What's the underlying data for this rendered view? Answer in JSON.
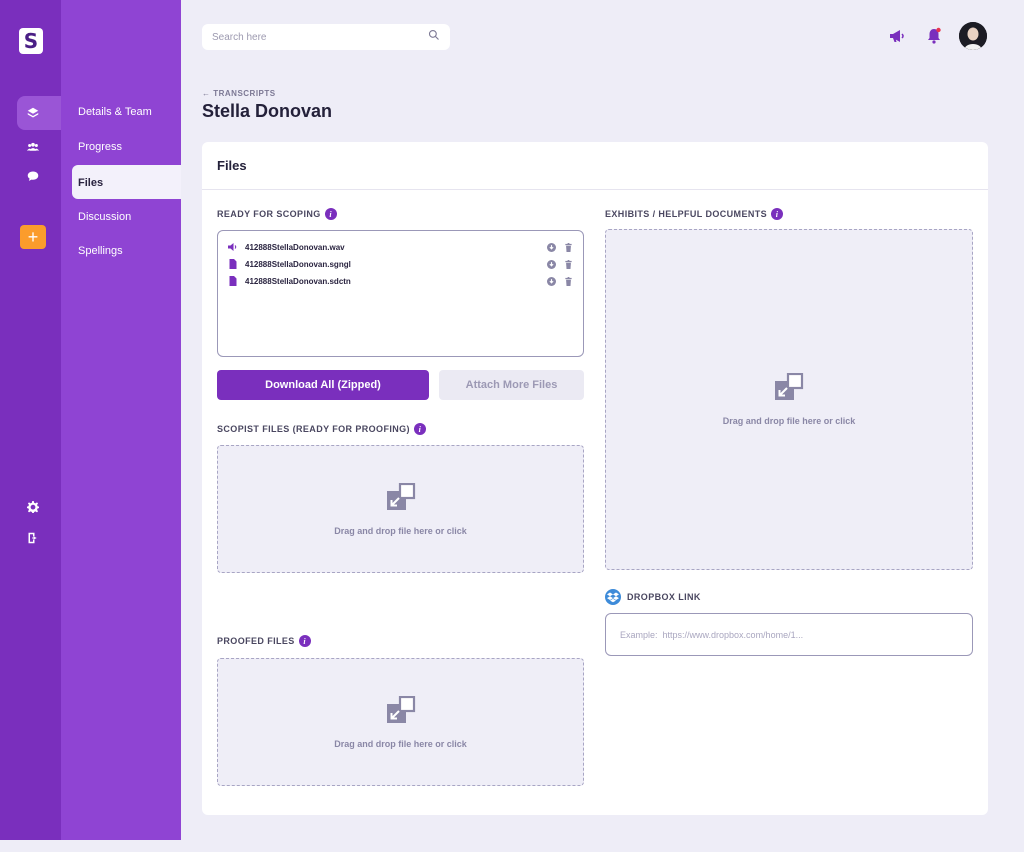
{
  "app": {
    "logo_letter": "S"
  },
  "rail": {
    "icons": [
      "layers-icon",
      "team-icon",
      "chat-icon",
      "add-icon",
      "settings-icon",
      "logout-icon"
    ],
    "add_label": "+"
  },
  "subnav": {
    "items": [
      {
        "label": "Details & Team"
      },
      {
        "label": "Progress"
      },
      {
        "label": "Files"
      },
      {
        "label": "Discussion"
      },
      {
        "label": "Spellings"
      }
    ],
    "active": "Files"
  },
  "search": {
    "placeholder": "Search here",
    "value": ""
  },
  "header": {
    "breadcrumb": "← TRANSCRIPTS",
    "title": "Stella Donovan"
  },
  "card": {
    "title": "Files",
    "ready_for_scoping": {
      "label": "READY FOR SCOPING",
      "files": [
        {
          "name": "412888StellaDonovan.wav",
          "icon": "audio-icon"
        },
        {
          "name": "412888StellaDonovan.sgngl",
          "icon": "file-icon"
        },
        {
          "name": "412888StellaDonovan.sdctn",
          "icon": "file-icon"
        }
      ],
      "download_all": "Download All (Zipped)",
      "attach_more": "Attach More Files"
    },
    "scopist_files": {
      "label": "SCOPIST FILES (READY FOR PROOFING)",
      "drop_text": "Drag and drop file here or click"
    },
    "proofed_files": {
      "label": "PROOFED FILES",
      "drop_text": "Drag and drop file here or click"
    },
    "exhibits": {
      "label": "EXHIBITS / HELPFUL DOCUMENTS",
      "drop_text": "Drag and drop file here or click"
    },
    "dropbox": {
      "label": "DROPBOX LINK",
      "placeholder": "Example:  https://www.dropbox.com/home/1...",
      "value": ""
    }
  },
  "colors": {
    "primary": "#7a2fbd",
    "rail": "#7a2fbd",
    "subnav": "#8f44d3",
    "accent_orange": "#fb9c2c",
    "dropbox_blue": "#3d8bd9",
    "notification_red": "#e8344e"
  }
}
